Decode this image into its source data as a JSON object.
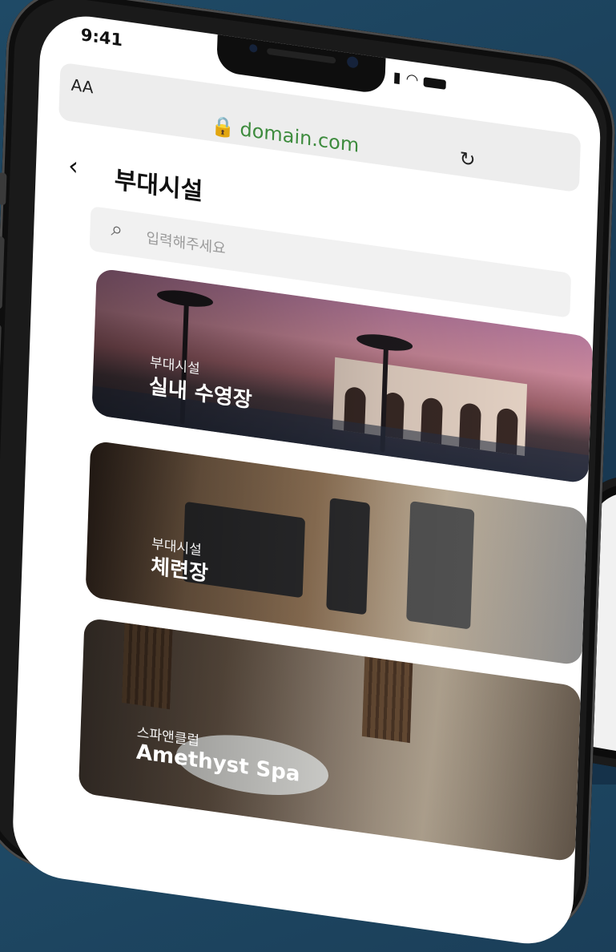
{
  "status_bar": {
    "time": "9:41"
  },
  "browser": {
    "text_size_label": "AA",
    "url": "domain.com",
    "lock_icon": "lock-icon",
    "reload_icon": "reload-icon"
  },
  "header": {
    "back_icon": "back-chevron-icon",
    "title": "부대시설"
  },
  "search": {
    "icon": "search-icon",
    "placeholder": "입력해주세요"
  },
  "facilities": [
    {
      "category": "부대시설",
      "name": "실내 수영장"
    },
    {
      "category": "부대시설",
      "name": "체련장"
    },
    {
      "category": "스파앤클럽",
      "name": "Amethyst Spa"
    }
  ],
  "colors": {
    "background": "#1f4a66",
    "url_green": "#3d8b3d",
    "browser_bar": "#ededed"
  }
}
